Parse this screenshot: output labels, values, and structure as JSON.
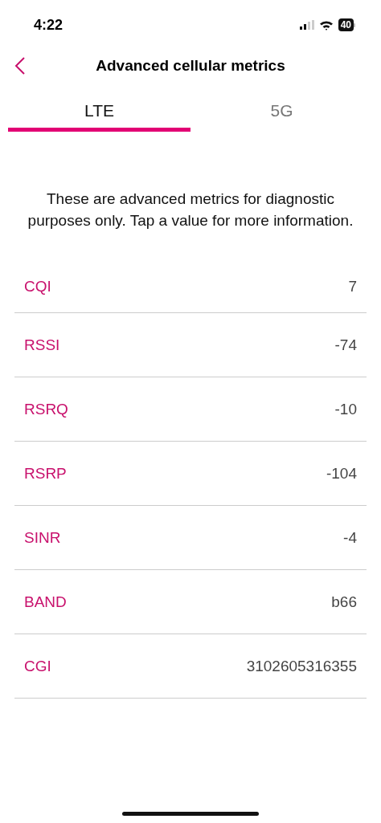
{
  "status_bar": {
    "time": "4:22",
    "battery": "40"
  },
  "header": {
    "title": "Advanced cellular metrics"
  },
  "tabs": [
    {
      "label": "LTE",
      "selected": true
    },
    {
      "label": "5G",
      "selected": false
    }
  ],
  "description": "These are advanced metrics for diagnostic purposes only. Tap a value for more information.",
  "metrics": [
    {
      "name": "CQI",
      "value": "7"
    },
    {
      "name": "RSSI",
      "value": "-74"
    },
    {
      "name": "RSRQ",
      "value": "-10"
    },
    {
      "name": "RSRP",
      "value": "-104"
    },
    {
      "name": "SINR",
      "value": "-4"
    },
    {
      "name": "BAND",
      "value": "b66"
    },
    {
      "name": "CGI",
      "value": "3102605316355"
    }
  ]
}
